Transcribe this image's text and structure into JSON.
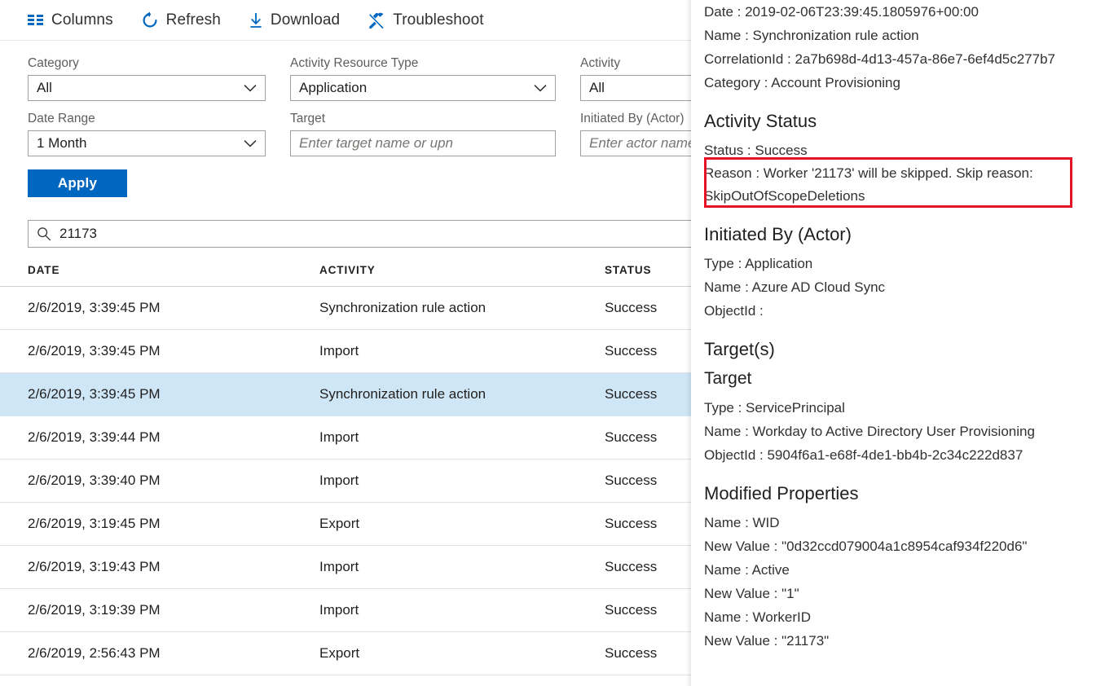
{
  "toolbar": {
    "buttons": [
      {
        "label": "Columns",
        "icon": "columns-icon"
      },
      {
        "label": "Refresh",
        "icon": "refresh-icon"
      },
      {
        "label": "Download",
        "icon": "download-icon"
      },
      {
        "label": "Troubleshoot",
        "icon": "troubleshoot-icon"
      }
    ]
  },
  "filters": {
    "category": {
      "label": "Category",
      "value": "All"
    },
    "activity_resource_type": {
      "label": "Activity Resource Type",
      "value": "Application"
    },
    "activity": {
      "label": "Activity",
      "value": "All"
    },
    "date_range": {
      "label": "Date Range",
      "value": "1 Month"
    },
    "target": {
      "label": "Target",
      "placeholder": "Enter target name or upn"
    },
    "initiated_by": {
      "label": "Initiated By (Actor)",
      "placeholder": "Enter actor name or"
    },
    "apply_label": "Apply"
  },
  "search": {
    "value": "21173",
    "icon": "search-icon"
  },
  "table": {
    "columns": [
      "DATE",
      "ACTIVITY",
      "STATUS"
    ],
    "rows": [
      {
        "date": "2/6/2019, 3:39:45 PM",
        "activity": "Synchronization rule action",
        "status": "Success",
        "selected": false
      },
      {
        "date": "2/6/2019, 3:39:45 PM",
        "activity": "Import",
        "status": "Success",
        "selected": false
      },
      {
        "date": "2/6/2019, 3:39:45 PM",
        "activity": "Synchronization rule action",
        "status": "Success",
        "selected": true
      },
      {
        "date": "2/6/2019, 3:39:44 PM",
        "activity": "Import",
        "status": "Success",
        "selected": false
      },
      {
        "date": "2/6/2019, 3:39:40 PM",
        "activity": "Import",
        "status": "Success",
        "selected": false
      },
      {
        "date": "2/6/2019, 3:19:45 PM",
        "activity": "Export",
        "status": "Success",
        "selected": false
      },
      {
        "date": "2/6/2019, 3:19:43 PM",
        "activity": "Import",
        "status": "Success",
        "selected": false
      },
      {
        "date": "2/6/2019, 3:19:39 PM",
        "activity": "Import",
        "status": "Success",
        "selected": false
      },
      {
        "date": "2/6/2019, 2:56:43 PM",
        "activity": "Export",
        "status": "Success",
        "selected": false
      }
    ]
  },
  "detail": {
    "activity": {
      "date": "Date : 2019-02-06T23:39:45.1805976+00:00",
      "name": "Name : Synchronization rule action",
      "correlation_id": "CorrelationId : 2a7b698d-4d13-457a-86e7-6ef4d5c277b7",
      "category": "Category : Account Provisioning"
    },
    "activity_status": {
      "heading": "Activity Status",
      "status": "Status : Success",
      "reason": "Reason : Worker '21173' will be skipped. Skip reason: SkipOutOfScopeDeletions"
    },
    "initiated_by": {
      "heading": "Initiated By (Actor)",
      "type": "Type : Application",
      "name": "Name : Azure AD Cloud Sync",
      "object_id": "ObjectId :"
    },
    "targets": {
      "heading": "Target(s)",
      "sub_heading": "Target",
      "type": "Type : ServicePrincipal",
      "name": "Name : Workday to Active Directory User Provisioning",
      "object_id": "ObjectId : 5904f6a1-e68f-4de1-bb4b-2c34c222d837"
    },
    "modified_properties": {
      "heading": "Modified Properties",
      "entries": [
        {
          "name": "Name : WID",
          "new_value": "New Value : \"0d32ccd079004a1c8954caf934f220d6\""
        },
        {
          "name": "Name : Active",
          "new_value": "New Value : \"1\""
        },
        {
          "name": "Name : WorkerID",
          "new_value": "New Value : \"21173\""
        }
      ]
    }
  },
  "colors": {
    "accent": "#0067c0",
    "highlight_box": "#e81123",
    "selected_row": "#cfe6f7"
  }
}
